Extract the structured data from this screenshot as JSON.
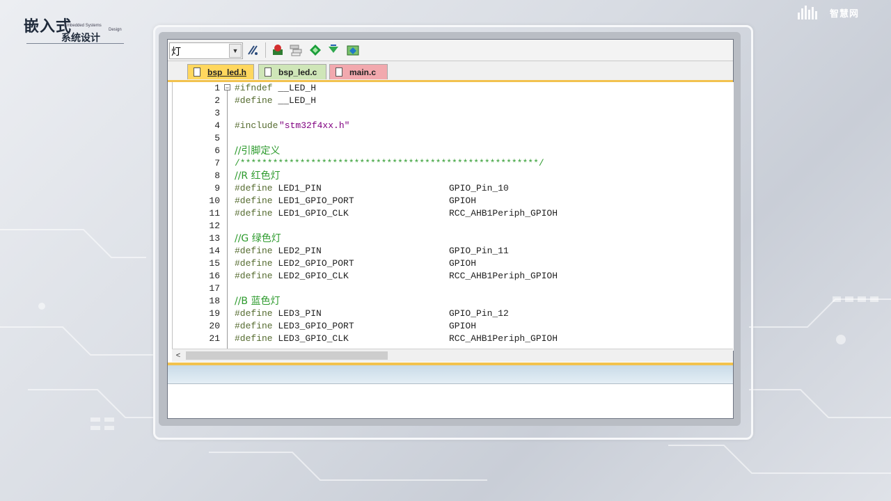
{
  "brand": {
    "logo_big": "嵌入式",
    "logo_small": "系统设计",
    "logo_en1": "Embedded Systems",
    "logo_en2": "Design",
    "right_logo": "智慧网"
  },
  "toolbar": {
    "combo_value": "灯",
    "icons": [
      "find-in-files-icon",
      "breakpoint-insert-icon",
      "breakpoint-list-icon",
      "run-diamond-icon",
      "step-icon",
      "configure-icon"
    ]
  },
  "tabs": [
    {
      "label": "bsp_led.h",
      "active": true,
      "color": "#ffd75e"
    },
    {
      "label": "bsp_led.c",
      "active": false,
      "color": "#cfe6b8"
    },
    {
      "label": "main.c",
      "active": false,
      "color": "#f2a9ae"
    }
  ],
  "editor": {
    "lines": [
      {
        "n": "1",
        "directive": "#ifndef",
        "name": " __LED_H",
        "value": ""
      },
      {
        "n": "2",
        "directive": "#define",
        "name": " __LED_H",
        "value": ""
      },
      {
        "n": "3",
        "directive": "",
        "name": "",
        "value": ""
      },
      {
        "n": "4",
        "directive": "#include",
        "name": "",
        "value": "\"stm32f4xx.h\""
      },
      {
        "n": "5",
        "directive": "",
        "name": "",
        "value": ""
      },
      {
        "n": "6",
        "comment": "//引脚定义"
      },
      {
        "n": "7",
        "comment": "/*******************************************************/"
      },
      {
        "n": "8",
        "comment": "//R 红色灯"
      },
      {
        "n": "9",
        "directive": "#define",
        "name": " LED1_PIN",
        "value": "GPIO_Pin_10"
      },
      {
        "n": "10",
        "directive": "#define",
        "name": " LED1_GPIO_PORT",
        "value": "GPIOH"
      },
      {
        "n": "11",
        "directive": "#define",
        "name": " LED1_GPIO_CLK",
        "value": "RCC_AHB1Periph_GPIOH"
      },
      {
        "n": "12",
        "directive": "",
        "name": "",
        "value": ""
      },
      {
        "n": "13",
        "comment": "//G 绿色灯"
      },
      {
        "n": "14",
        "directive": "#define",
        "name": " LED2_PIN",
        "value": "GPIO_Pin_11"
      },
      {
        "n": "15",
        "directive": "#define",
        "name": " LED2_GPIO_PORT",
        "value": "GPIOH"
      },
      {
        "n": "16",
        "directive": "#define",
        "name": " LED2_GPIO_CLK",
        "value": "RCC_AHB1Periph_GPIOH"
      },
      {
        "n": "17",
        "directive": "",
        "name": "",
        "value": ""
      },
      {
        "n": "18",
        "comment": "//B 蓝色灯"
      },
      {
        "n": "19",
        "directive": "#define",
        "name": " LED3_PIN",
        "value": "GPIO_Pin_12"
      },
      {
        "n": "20",
        "directive": "#define",
        "name": " LED3_GPIO_PORT",
        "value": "GPIOH"
      },
      {
        "n": "21",
        "directive": "#define",
        "name": " LED3_GPIO_CLK",
        "value": "RCC_AHB1Periph_GPIOH"
      }
    ]
  },
  "scrollbar": {
    "left_arrow": "<"
  },
  "colors": {
    "keyword": "#556b2f",
    "comment": "#2c9a2c",
    "string": "#800080",
    "active_tab": "#ffd75e"
  }
}
